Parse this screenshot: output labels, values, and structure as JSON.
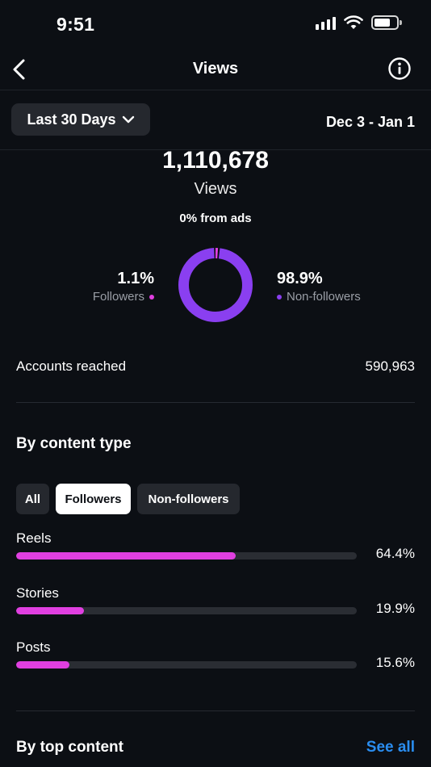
{
  "status_bar": {
    "time": "9:51"
  },
  "header": {
    "title": "Views"
  },
  "filter": {
    "range_label": "Last 30 Days",
    "date_range": "Dec 3 - Jan 1"
  },
  "summary": {
    "total_views": "1,110,678",
    "views_label": "Views",
    "ads_share": "0% from ads",
    "followers_pct": "1.1%",
    "followers_label": "Followers",
    "non_followers_pct": "98.9%",
    "non_followers_label": "Non-followers",
    "followers_share": 0.011,
    "colors": {
      "followers": "#e03fe0",
      "non_followers": "#8a3ff0"
    }
  },
  "accounts_reached": {
    "label": "Accounts reached",
    "value": "590,963"
  },
  "by_content_type": {
    "title": "By content type",
    "tabs": [
      {
        "label": "All",
        "active": false
      },
      {
        "label": "Followers",
        "active": true
      },
      {
        "label": "Non-followers",
        "active": false
      }
    ],
    "bars": [
      {
        "label": "Reels",
        "value": 64.4,
        "pct_text": "64.4%"
      },
      {
        "label": "Stories",
        "value": 19.9,
        "pct_text": "19.9%"
      },
      {
        "label": "Posts",
        "value": 15.6,
        "pct_text": "15.6%"
      }
    ],
    "bar_color": "#e03fe0"
  },
  "by_top_content": {
    "title": "By top content",
    "see_all": "See all"
  }
}
